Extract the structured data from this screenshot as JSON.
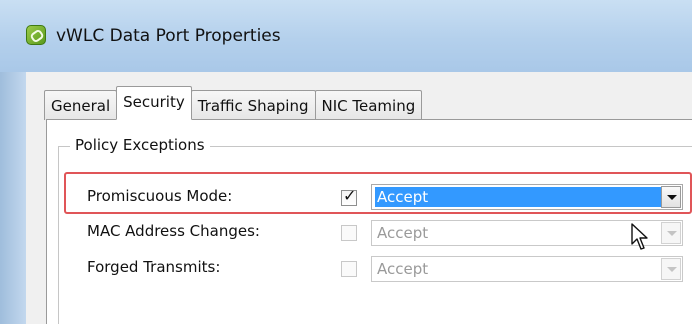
{
  "window": {
    "title": "vWLC Data Port Properties",
    "icon": "vmware-port-icon"
  },
  "tabs": [
    {
      "label": "General",
      "active": false
    },
    {
      "label": "Security",
      "active": true
    },
    {
      "label": "Traffic Shaping",
      "active": false
    },
    {
      "label": "NIC Teaming",
      "active": false
    }
  ],
  "policy_exceptions": {
    "legend": "Policy Exceptions",
    "rows": [
      {
        "label": "Promiscuous Mode:",
        "checked": true,
        "value": "Accept",
        "enabled": true
      },
      {
        "label": "MAC Address Changes:",
        "checked": false,
        "value": "Accept",
        "enabled": false
      },
      {
        "label": "Forged Transmits:",
        "checked": false,
        "value": "Accept",
        "enabled": false
      }
    ]
  },
  "annotation": {
    "color": "#e05558"
  },
  "colors": {
    "selection": "#3399ff",
    "titlebar": "#b4d0ec"
  }
}
